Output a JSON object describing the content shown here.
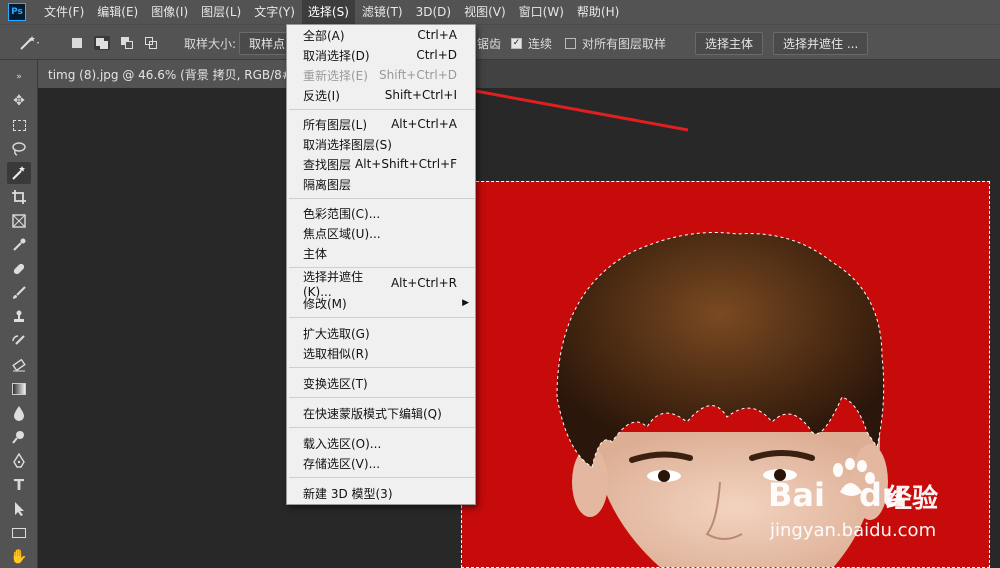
{
  "app": {
    "logo_text": "Ps"
  },
  "menubar": {
    "items": [
      "文件(F)",
      "编辑(E)",
      "图像(I)",
      "图层(L)",
      "文字(Y)",
      "选择(S)",
      "滤镜(T)",
      "3D(D)",
      "视图(V)",
      "窗口(W)",
      "帮助(H)"
    ],
    "active": "选择(S)"
  },
  "options": {
    "sample_size_label": "取样大小:",
    "sample_size_value": "取样点",
    "antialias_tail": "锯齿",
    "contiguous_label": "连续",
    "contiguous_checked": true,
    "all_layers_label": "对所有图层取样",
    "all_layers_checked": false,
    "select_subject": "选择主体",
    "select_and_mask": "选择并遮住 ..."
  },
  "document_tab": {
    "title": "timg (8).jpg @ 46.6% (背景 拷贝, RGB/8#) *",
    "close": "×"
  },
  "select_menu": {
    "items": [
      {
        "label": "全部(A)",
        "shortcut": "Ctrl+A",
        "disabled": false
      },
      {
        "label": "取消选择(D)",
        "shortcut": "Ctrl+D",
        "disabled": false
      },
      {
        "label": "重新选择(E)",
        "shortcut": "Shift+Ctrl+D",
        "disabled": true
      },
      {
        "label": "反选(I)",
        "shortcut": "Shift+Ctrl+I",
        "disabled": false
      },
      {
        "label": "所有图层(L)",
        "shortcut": "Alt+Ctrl+A",
        "disabled": false
      },
      {
        "label": "取消选择图层(S)",
        "shortcut": "",
        "disabled": false
      },
      {
        "label": "查找图层",
        "shortcut": "Alt+Shift+Ctrl+F",
        "disabled": false
      },
      {
        "label": "隔离图层",
        "shortcut": "",
        "disabled": false
      },
      {
        "label": "色彩范围(C)...",
        "shortcut": "",
        "disabled": false
      },
      {
        "label": "焦点区域(U)...",
        "shortcut": "",
        "disabled": false
      },
      {
        "label": "主体",
        "shortcut": "",
        "disabled": false
      },
      {
        "label": "选择并遮住(K)...",
        "shortcut": "Alt+Ctrl+R",
        "disabled": false
      },
      {
        "label": "修改(M)",
        "shortcut": "",
        "disabled": false
      },
      {
        "label": "扩大选取(G)",
        "shortcut": "",
        "disabled": false
      },
      {
        "label": "选取相似(R)",
        "shortcut": "",
        "disabled": false
      },
      {
        "label": "变换选区(T)",
        "shortcut": "",
        "disabled": false
      },
      {
        "label": "在快速蒙版模式下编辑(Q)",
        "shortcut": "",
        "disabled": false
      },
      {
        "label": "载入选区(O)...",
        "shortcut": "",
        "disabled": false
      },
      {
        "label": "存储选区(V)...",
        "shortcut": "",
        "disabled": false
      },
      {
        "label": "新建 3D 模型(3)",
        "shortcut": "",
        "disabled": false
      }
    ]
  },
  "watermark": {
    "brand": "Bai",
    "brand2": "du",
    "cn": "经验",
    "url": "jingyan.baidu.com"
  },
  "colors": {
    "background_red": "#c70a0a",
    "arrow_red": "#e02020",
    "menu_bg": "#f0f0f0"
  }
}
